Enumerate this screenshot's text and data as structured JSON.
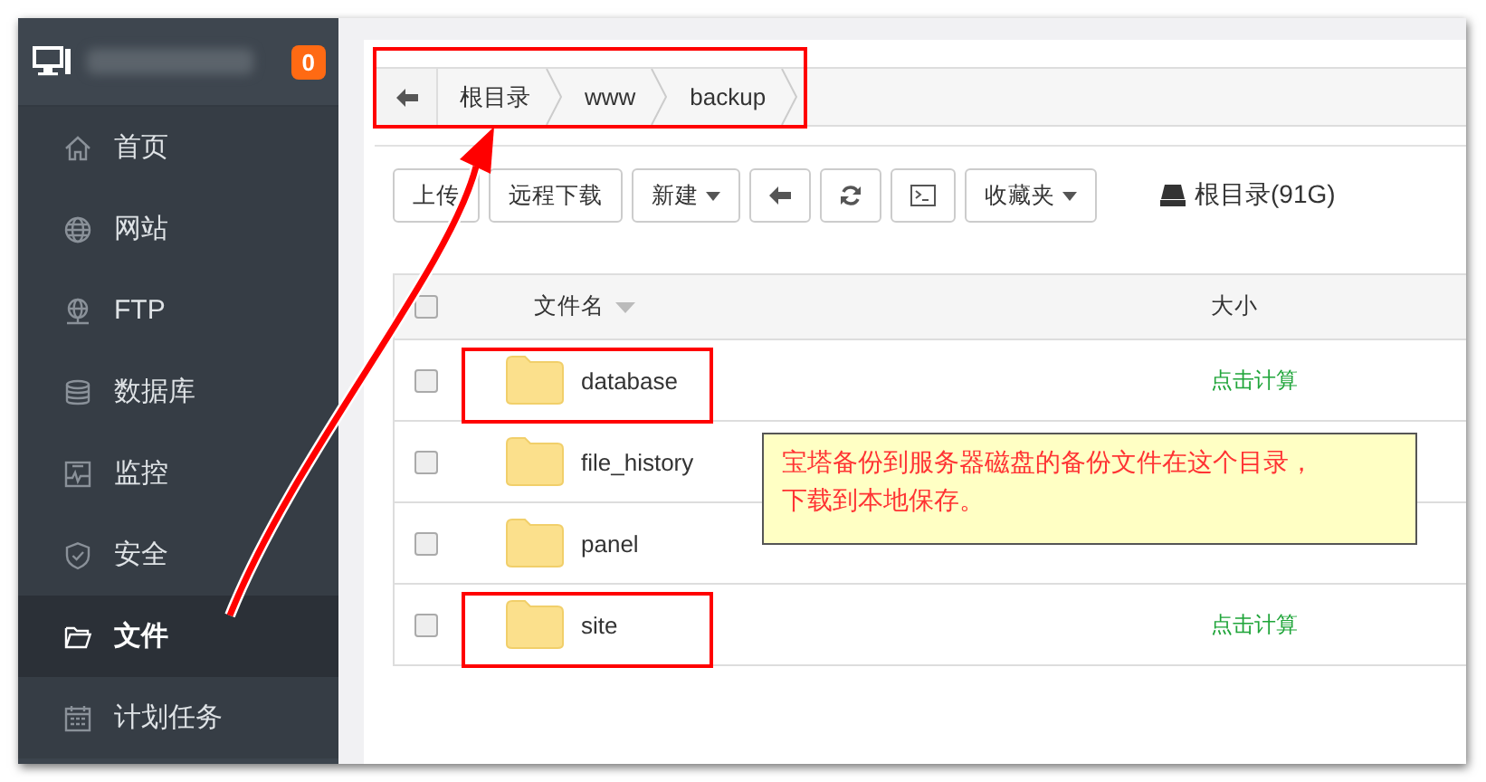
{
  "sidebar": {
    "badge": "0",
    "items": [
      {
        "label": "首页",
        "kind": "home",
        "selected": false
      },
      {
        "label": "网站",
        "kind": "globe",
        "selected": false
      },
      {
        "label": "FTP",
        "kind": "ftp",
        "selected": false
      },
      {
        "label": "数据库",
        "kind": "database",
        "selected": false
      },
      {
        "label": "监控",
        "kind": "monitor",
        "selected": false
      },
      {
        "label": "安全",
        "kind": "shield",
        "selected": false
      },
      {
        "label": "文件",
        "kind": "folder",
        "selected": true
      },
      {
        "label": "计划任务",
        "kind": "calendar",
        "selected": false
      }
    ]
  },
  "breadcrumb": {
    "highlighted": true,
    "items": [
      "根目录",
      "www",
      "backup"
    ]
  },
  "toolbar": {
    "buttons": [
      {
        "kind": "text",
        "label": "上传"
      },
      {
        "kind": "text",
        "label": "远程下载"
      },
      {
        "kind": "dropdown",
        "label": "新建"
      },
      {
        "kind": "back"
      },
      {
        "kind": "refresh"
      },
      {
        "kind": "terminal"
      },
      {
        "kind": "dropdown",
        "label": "收藏夹"
      }
    ],
    "disk": "根目录(91G)"
  },
  "table": {
    "columns": [
      "文件名",
      "大小"
    ],
    "all_checked": false,
    "rows": [
      {
        "name": "database",
        "size": "点击计算",
        "checked": false,
        "highlighted": true
      },
      {
        "name": "file_history",
        "checked": false,
        "highlighted": false
      },
      {
        "name": "panel",
        "checked": false,
        "highlighted": false
      },
      {
        "name": "site",
        "size": "点击计算",
        "checked": false,
        "highlighted": true
      }
    ]
  },
  "note": {
    "lines": [
      "宝塔备份到服务器磁盘的备份文件在这个目录，",
      "下载到本地保存。"
    ]
  }
}
